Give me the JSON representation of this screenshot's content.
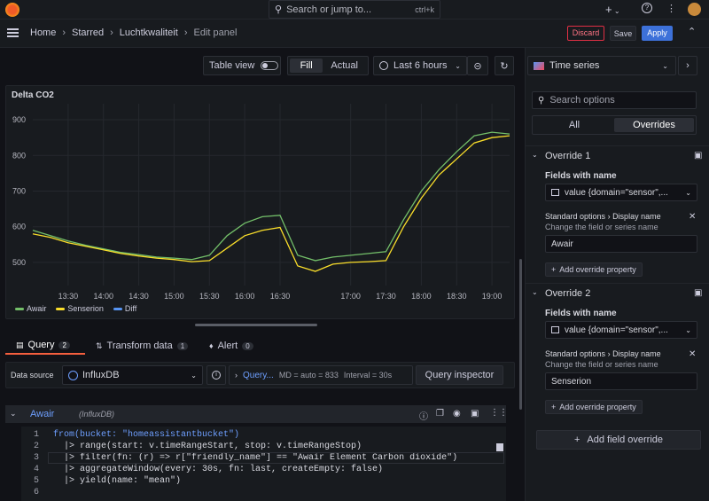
{
  "topbar": {
    "search_placeholder": "Search or jump to...",
    "shortcut": "ctrl+k",
    "plus": "+"
  },
  "breadcrumb": [
    "Home",
    "Starred",
    "Luchtkwaliteit",
    "Edit panel"
  ],
  "actions": {
    "discard": "Discard",
    "save": "Save",
    "apply": "Apply"
  },
  "toolbar": {
    "table_view": "Table view",
    "fill": "Fill",
    "actual": "Actual",
    "time_range": "Last 6 hours"
  },
  "panel": {
    "title": "Delta CO2"
  },
  "viz_picker": {
    "label": "Time series"
  },
  "options": {
    "search_placeholder": "Search options",
    "tab_all": "All",
    "tab_overrides": "Overrides"
  },
  "overrides": [
    {
      "title": "Override 1",
      "fields_label": "Fields with name",
      "field_value": "value {domain=\"sensor\",...",
      "std": "Standard options",
      "prop": "Display name",
      "desc": "Change the field or series name",
      "value": "Awair",
      "add_prop": "Add override property"
    },
    {
      "title": "Override 2",
      "fields_label": "Fields with name",
      "field_value": "value {domain=\"sensor\",...",
      "std": "Standard options",
      "prop": "Display name",
      "desc": "Change the field or series name",
      "value": "Senserion",
      "add_prop": "Add override property"
    }
  ],
  "add_field_override": "Add field override",
  "query_tabs": [
    {
      "label": "Query",
      "count": "2"
    },
    {
      "label": "Transform data",
      "count": "1"
    },
    {
      "label": "Alert",
      "count": "0"
    }
  ],
  "datasource": {
    "label": "Data source",
    "name": "InfluxDB",
    "query_options": "Query...",
    "md": "MD = auto = 833",
    "interval": "Interval = 30s",
    "inspector": "Query inspector"
  },
  "query_row": {
    "name": "Awair",
    "source": "(InfluxDB)"
  },
  "code": {
    "line_numbers": [
      "1",
      "2",
      "3",
      "4",
      "5",
      "6"
    ],
    "lines": [
      "from(bucket: \"homeassistantbucket\")",
      "  |> range(start: v.timeRangeStart, stop: v.timeRangeStop)",
      "  |> filter(fn: (r) => r[\"friendly_name\"] == \"Awair Element Carbon dioxide\")",
      "  |> aggregateWindow(every: 30s, fn: last, createEmpty: false)",
      "  |> yield(name: \"mean\")",
      ""
    ]
  },
  "colors": {
    "awair": "#73bf69",
    "senserion": "#fade2a",
    "diff": "#5794f2",
    "accent": "#3d71d9",
    "discard": "#e02f44"
  },
  "chart_data": {
    "type": "line",
    "x": [
      "13:00",
      "13:15",
      "13:30",
      "13:45",
      "14:00",
      "14:15",
      "14:30",
      "14:45",
      "15:00",
      "15:15",
      "15:30",
      "15:45",
      "16:00",
      "16:15",
      "16:30",
      "16:35",
      "16:40",
      "16:45",
      "17:00",
      "17:15",
      "17:30",
      "17:45",
      "18:00",
      "18:15",
      "18:30",
      "18:45",
      "19:00",
      "19:15"
    ],
    "x_ticks": [
      "13:30",
      "14:00",
      "14:30",
      "15:00",
      "15:30",
      "16:00",
      "16:30",
      "17:00",
      "17:30",
      "18:00",
      "18:30",
      "19:00"
    ],
    "y_ticks": [
      "500",
      "600",
      "700",
      "800",
      "900"
    ],
    "ylim": [
      460,
      920
    ],
    "series": [
      {
        "name": "Awair",
        "values": [
          590,
          575,
          560,
          548,
          538,
          528,
          522,
          515,
          512,
          508,
          520,
          575,
          610,
          628,
          632,
          520,
          505,
          515,
          520,
          525,
          530,
          620,
          700,
          760,
          810,
          855,
          865,
          860
        ]
      },
      {
        "name": "Senserion",
        "values": [
          580,
          570,
          555,
          545,
          535,
          525,
          518,
          512,
          508,
          502,
          505,
          540,
          575,
          590,
          598,
          490,
          475,
          495,
          500,
          502,
          505,
          600,
          680,
          745,
          790,
          835,
          850,
          855
        ]
      },
      {
        "name": "Diff",
        "values": []
      }
    ]
  }
}
